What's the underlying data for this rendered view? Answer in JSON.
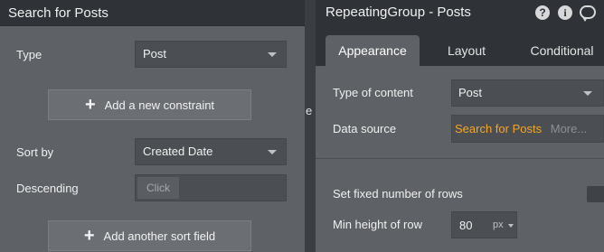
{
  "left_panel": {
    "title": "Search for Posts",
    "type_label": "Type",
    "type_value": "Post",
    "add_constraint_label": "Add a new constraint",
    "sort_by_label": "Sort by",
    "sort_by_value": "Created Date",
    "descending_label": "Descending",
    "descending_value": "Click",
    "add_sort_label": "Add another sort field"
  },
  "sliver": {
    "letter": "e"
  },
  "right_panel": {
    "title": "RepeatingGroup - Posts",
    "icons": [
      "help-icon",
      "info-icon",
      "comment-icon"
    ],
    "help_glyph": "?",
    "info_glyph": "i",
    "tabs": [
      {
        "label": "Appearance",
        "active": true
      },
      {
        "label": "Layout",
        "active": false
      },
      {
        "label": "Conditional",
        "active": false
      }
    ],
    "type_of_content_label": "Type of content",
    "type_of_content_value": "Post",
    "data_source_label": "Data source",
    "data_source_value": "Search for Posts",
    "data_source_more": "More...",
    "fixed_rows_label": "Set fixed number of rows",
    "min_height_label": "Min height of row",
    "min_height_value": "80",
    "min_height_unit": "px"
  },
  "colors": {
    "panel_bg": "#5e6165",
    "header_bg": "#2f3337",
    "accent_orange": "#f5a623"
  }
}
